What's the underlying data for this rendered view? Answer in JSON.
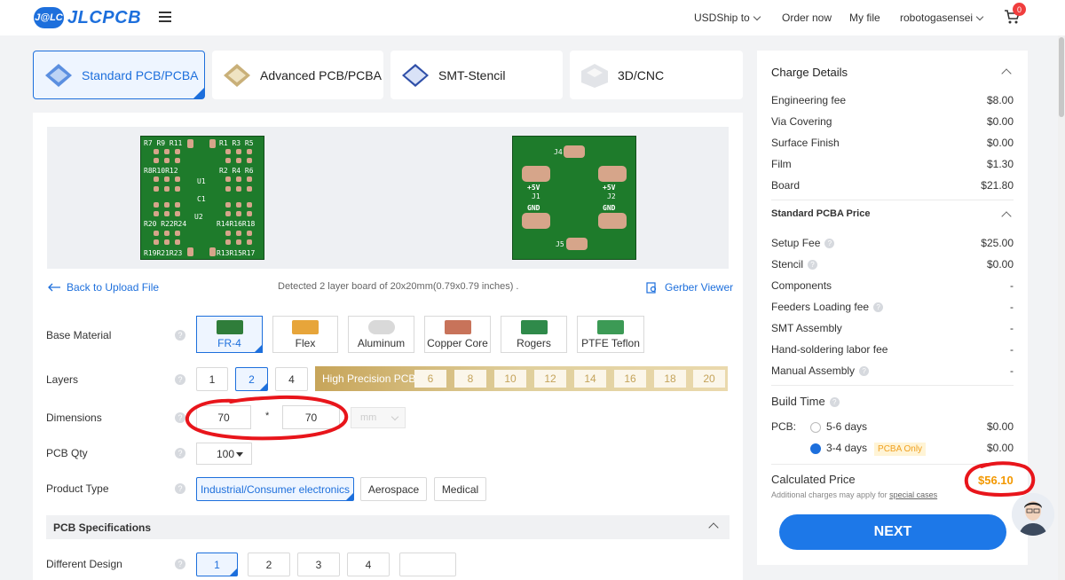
{
  "header": {
    "logo_badge": "J@LC",
    "logo_text": "JLCPCB",
    "currency_ship": "USDShip to",
    "order_now": "Order now",
    "my_file": "My file",
    "username": "robotogasensei",
    "cart_count": "0"
  },
  "tabs": [
    {
      "label": "Standard PCB/PCBA",
      "active": true
    },
    {
      "label": "Advanced PCB/PCBA",
      "active": false
    },
    {
      "label": "SMT-Stencil",
      "active": false
    },
    {
      "label": "3D/CNC",
      "active": false
    }
  ],
  "preview": {
    "back_link": "Back to Upload File",
    "detected": "Detected 2 layer board of 20x20mm(0.79x0.79 inches) .",
    "gerber_viewer": "Gerber Viewer",
    "left_silk": [
      "R7 R9 R11",
      "R1 R3 R5",
      "R8R10R12",
      "R2 R4 R6",
      "U1",
      "C1",
      "U2",
      "R20 R22R24",
      "R14R16R18",
      "R19R21R23",
      "R13R15R17"
    ],
    "right_silk": [
      "J4",
      "+5V",
      "J1",
      "GND",
      "+5V",
      "J2",
      "GND",
      "J5"
    ]
  },
  "form": {
    "base_material_label": "Base Material",
    "materials": [
      "FR-4",
      "Flex",
      "Aluminum",
      "Copper Core",
      "Rogers",
      "PTFE Teflon"
    ],
    "layers_label": "Layers",
    "layers": [
      "1",
      "2",
      "4"
    ],
    "high_precision_label": "High Precision PCB",
    "hp_layers": [
      "6",
      "8",
      "10",
      "12",
      "14",
      "16",
      "18",
      "20"
    ],
    "dimensions_label": "Dimensions",
    "dim_x": "70",
    "dim_sep": "*",
    "dim_y": "70",
    "dim_unit": "mm",
    "qty_label": "PCB Qty",
    "qty_value": "100",
    "product_type_label": "Product Type",
    "product_types": [
      "Industrial/Consumer electronics",
      "Aerospace",
      "Medical"
    ],
    "specs_label": "PCB Specifications",
    "diff_design_label": "Different Design",
    "diff_designs": [
      "1",
      "2",
      "3",
      "4"
    ]
  },
  "sidebar": {
    "charge_details": "Charge Details",
    "charges": [
      {
        "label": "Engineering fee",
        "value": "$8.00"
      },
      {
        "label": "Via Covering",
        "value": "$0.00"
      },
      {
        "label": "Surface Finish",
        "value": "$0.00"
      },
      {
        "label": "Film",
        "value": "$1.30"
      },
      {
        "label": "Board",
        "value": "$21.80"
      }
    ],
    "pcba_title": "Standard PCBA Price",
    "pcba": [
      {
        "label": "Setup Fee",
        "value": "$25.00"
      },
      {
        "label": "Stencil",
        "value": "$0.00"
      },
      {
        "label": "Components",
        "value": "-"
      },
      {
        "label": "Feeders Loading fee",
        "value": "-"
      },
      {
        "label": "SMT Assembly",
        "value": "-"
      },
      {
        "label": "Hand-soldering labor fee",
        "value": "-"
      },
      {
        "label": "Manual Assembly",
        "value": "-"
      }
    ],
    "build_time": "Build Time",
    "pcb_label": "PCB:",
    "build_options": [
      {
        "label": "5-6 days",
        "value": "$0.00",
        "selected": false
      },
      {
        "label": "3-4 days",
        "value": "$0.00",
        "selected": true
      }
    ],
    "pcba_only": "PCBA Only",
    "calculated_price_label": "Calculated Price",
    "calculated_price": "$56.10",
    "additional_note": "Additional charges may apply for",
    "special_cases": "special cases",
    "next": "NEXT"
  },
  "colors": {
    "accent": "#1d6fdc",
    "price": "#f39800",
    "annotation": "#e8151b"
  }
}
